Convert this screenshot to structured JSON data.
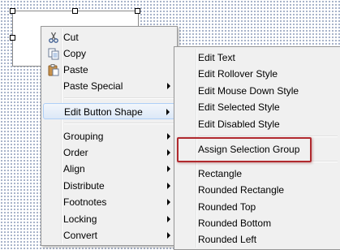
{
  "context_menu": {
    "items": [
      {
        "label": "Cut",
        "icon": "scissors-icon"
      },
      {
        "label": "Copy",
        "icon": "copy-icon"
      },
      {
        "label": "Paste",
        "icon": "paste-icon"
      },
      {
        "label": "Paste Special",
        "submenu": true
      },
      {
        "label": "Edit Button Shape",
        "submenu": true,
        "highlighted": true
      },
      {
        "label": "Grouping",
        "submenu": true
      },
      {
        "label": "Order",
        "submenu": true
      },
      {
        "label": "Align",
        "submenu": true
      },
      {
        "label": "Distribute",
        "submenu": true
      },
      {
        "label": "Footnotes",
        "submenu": true
      },
      {
        "label": "Locking",
        "submenu": true
      },
      {
        "label": "Convert",
        "submenu": true
      }
    ]
  },
  "submenu": {
    "items": [
      {
        "label": "Edit Text"
      },
      {
        "label": "Edit Rollover Style"
      },
      {
        "label": "Edit Mouse Down Style"
      },
      {
        "label": "Edit Selected Style"
      },
      {
        "label": "Edit Disabled Style"
      },
      {
        "label": "Assign Selection Group",
        "annotated": true
      },
      {
        "label": "Rectangle"
      },
      {
        "label": "Rounded Rectangle"
      },
      {
        "label": "Rounded Top"
      },
      {
        "label": "Rounded Bottom"
      },
      {
        "label": "Rounded Left"
      }
    ]
  },
  "colors": {
    "callout_border": "#b0292e",
    "canvas_dots": "#5a6f9a",
    "menu_bg": "#f0f0f0"
  }
}
